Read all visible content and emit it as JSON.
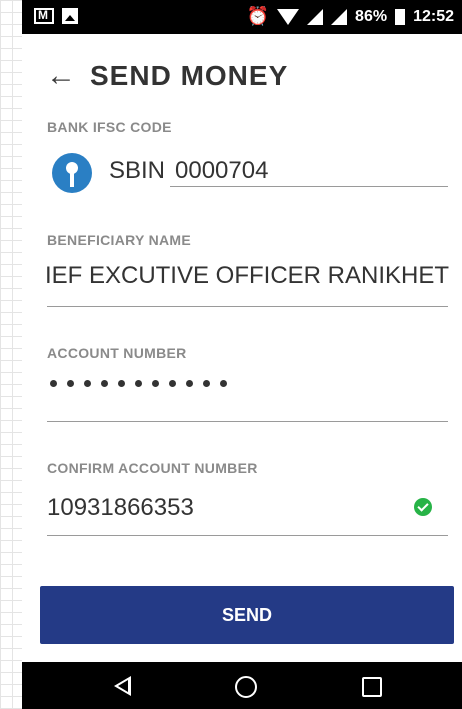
{
  "status_bar": {
    "battery": "86%",
    "time": "12:52",
    "icons": [
      "mail-icon",
      "image-icon",
      "alarm-icon",
      "wifi-icon",
      "signal-icon",
      "battery-icon"
    ]
  },
  "header": {
    "back_icon": "arrow-left-icon",
    "title": "SEND MONEY"
  },
  "form": {
    "ifsc": {
      "label": "BANK IFSC CODE",
      "prefix": "SBIN",
      "value": "0000704",
      "bank_icon": "sbi-logo-icon"
    },
    "beneficiary": {
      "label": "BENEFICIARY NAME",
      "value": "CHIEF EXCUTIVE OFFICER RANIKHET"
    },
    "account": {
      "label": "ACCOUNT NUMBER",
      "masked_length": 11
    },
    "confirm": {
      "label": "CONFIRM ACCOUNT NUMBER",
      "value": "10931866353",
      "status_icon": "check-circle-icon"
    }
  },
  "send_label": "SEND",
  "nav_bar": {
    "icons": [
      "nav-back-icon",
      "nav-home-icon",
      "nav-recents-icon"
    ]
  },
  "colors": {
    "primary": "#243a86",
    "success": "#27b347",
    "sbi_blue": "#2a7fc4"
  }
}
